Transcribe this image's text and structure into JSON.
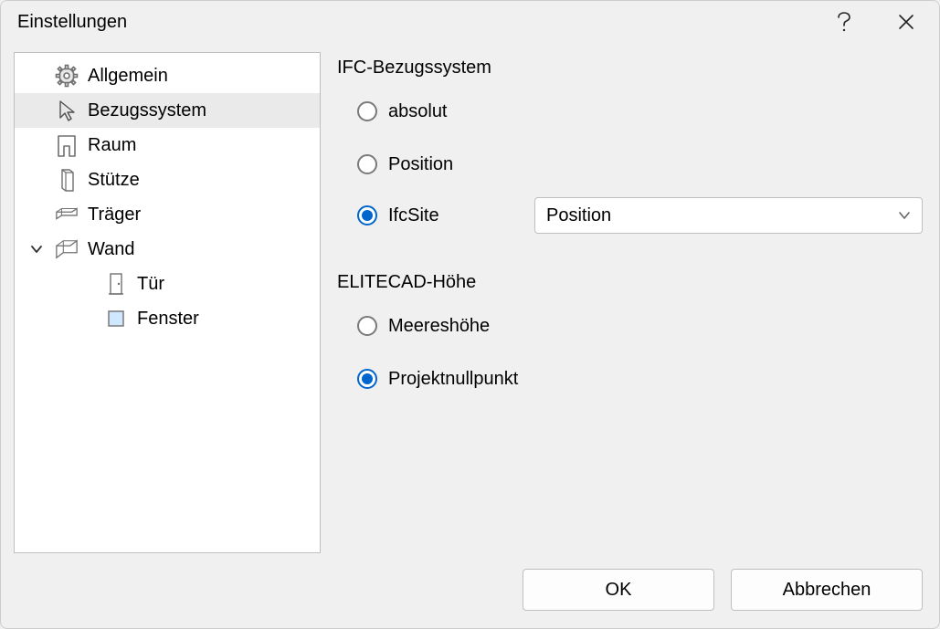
{
  "window": {
    "title": "Einstellungen"
  },
  "sidebar": {
    "items": [
      {
        "label": "Allgemein"
      },
      {
        "label": "Bezugssystem"
      },
      {
        "label": "Raum"
      },
      {
        "label": "Stütze"
      },
      {
        "label": "Träger"
      },
      {
        "label": "Wand"
      },
      {
        "label": "Tür"
      },
      {
        "label": "Fenster"
      }
    ]
  },
  "content": {
    "group1": {
      "title": "IFC-Bezugssystem",
      "options": {
        "absolut": "absolut",
        "position": "Position",
        "ifcsite": "IfcSite"
      },
      "ifcsite_select": "Position"
    },
    "group2": {
      "title": "ELITECAD-Höhe",
      "options": {
        "meereshoehe": "Meereshöhe",
        "projektnullpunkt": "Projektnullpunkt"
      }
    }
  },
  "footer": {
    "ok": "OK",
    "cancel": "Abbrechen"
  }
}
